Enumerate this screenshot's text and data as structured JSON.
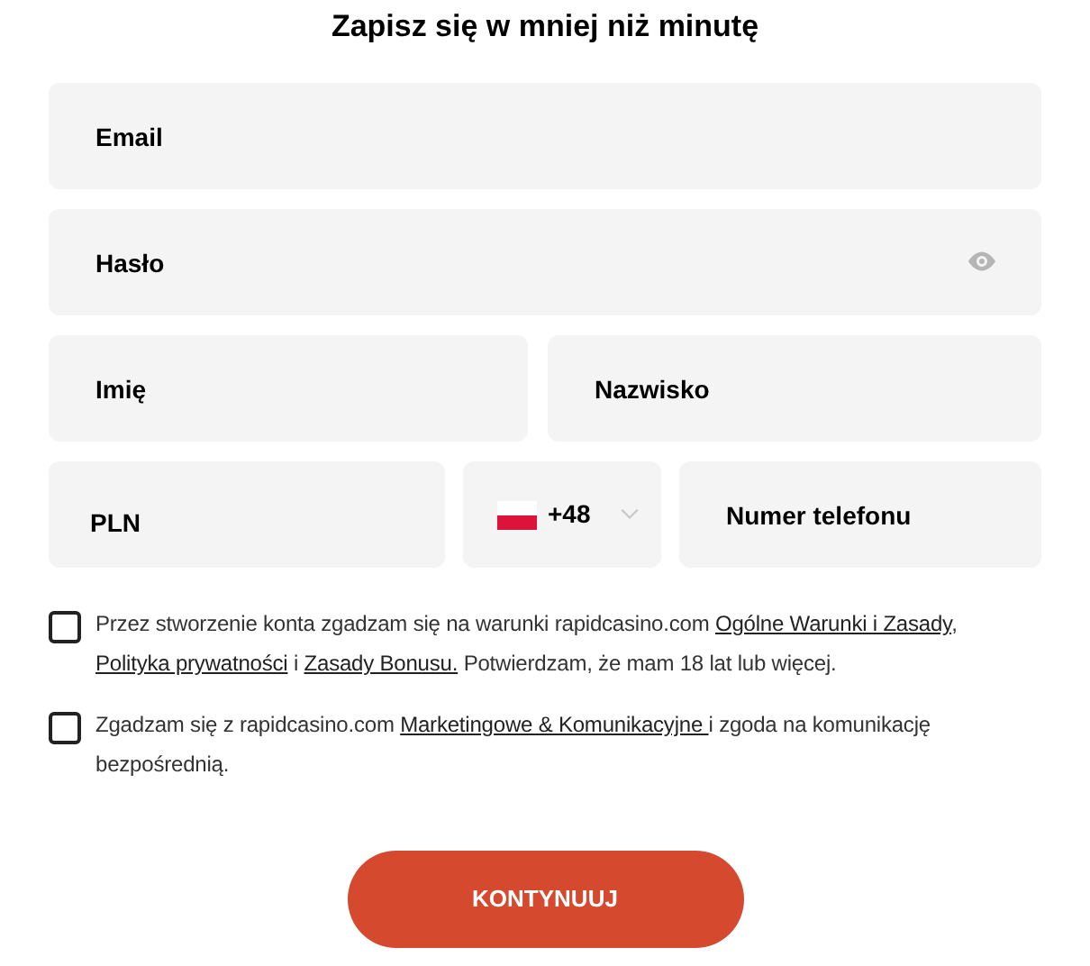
{
  "title": "Zapisz się w mniej niż minutę",
  "fields": [
    {
      "kind": "text",
      "placeholder": "Email"
    },
    {
      "kind": "password",
      "placeholder": "Hasło"
    },
    {
      "kind": "text",
      "placeholder": "Imię"
    },
    {
      "kind": "text",
      "placeholder": "Nazwisko"
    },
    {
      "kind": "currency",
      "value": "PLN"
    },
    {
      "kind": "phone_code",
      "value": "+48"
    },
    {
      "kind": "text",
      "placeholder": "Numer telefonu"
    }
  ],
  "consents": [
    {
      "checked": false,
      "parts": [
        {
          "kind": "text",
          "text": "Przez stworzenie konta zgadzam się na warunki rapidcasino.com "
        },
        {
          "kind": "link",
          "text": "Ogólne Warunki i Zasady"
        },
        {
          "kind": "text",
          "text": ", "
        },
        {
          "kind": "link",
          "text": "Polityka prywatności"
        },
        {
          "kind": "text",
          "text": " i "
        },
        {
          "kind": "link",
          "text": "Zasady Bonusu."
        },
        {
          "kind": "text",
          "text": " Potwierdzam, że mam 18 lat lub więcej."
        }
      ]
    },
    {
      "checked": false,
      "parts": [
        {
          "kind": "text",
          "text": "Zgadzam się z rapidcasino.com "
        },
        {
          "kind": "link",
          "text": "Marketingowe & Komunikacyjne "
        },
        {
          "kind": "text",
          "text": "i zgoda na komunikację bezpośrednią."
        }
      ]
    }
  ],
  "submit": "KONTYNUUJ"
}
